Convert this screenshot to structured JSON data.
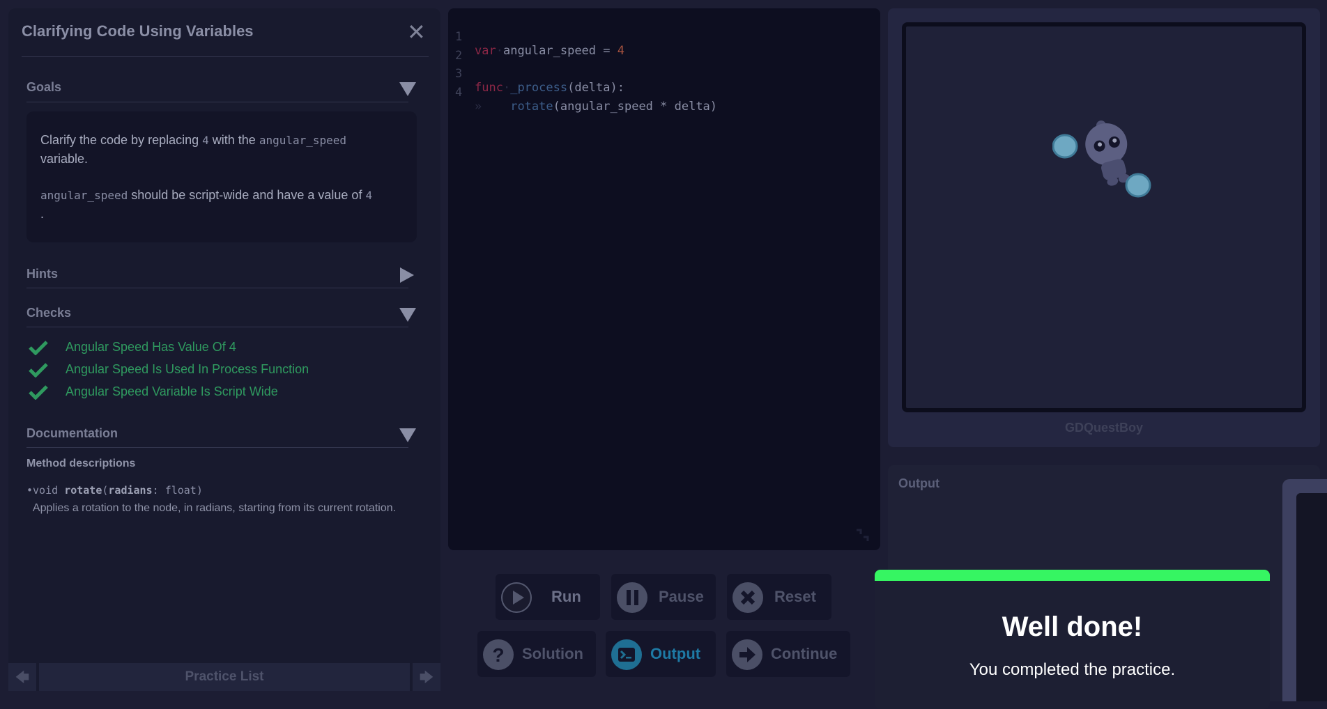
{
  "panel": {
    "title": "Clarifying Code Using Variables",
    "close_icon": "✕"
  },
  "goals": {
    "title": "Goals",
    "line1_a": "Clarify the code by replacing ",
    "line1_code1": "4",
    "line1_b": " with the ",
    "line1_code2": "angular_speed",
    "line1_c": "variable.",
    "line2_code1": "angular_speed",
    "line2_a": " should be script-wide and have a value of ",
    "line2_code2": "4",
    "line2_b": "."
  },
  "hints": {
    "title": "Hints"
  },
  "checks": {
    "title": "Checks",
    "items": [
      "Angular Speed Has Value Of 4",
      "Angular Speed Is Used In Process Function",
      "Angular Speed Variable Is Script Wide"
    ],
    "color": "#2f9a5f"
  },
  "documentation": {
    "title": "Documentation",
    "method_heading": "Method descriptions",
    "bullet": "•",
    "sig_void": "void ",
    "sig_name": "rotate",
    "sig_open": "(",
    "sig_param": "radians",
    "sig_colon": ": ",
    "sig_type": "float",
    "sig_close": ")",
    "description": "Applies a rotation to the node, in radians, starting from its current rotation."
  },
  "footer": {
    "prev_icon": "🡄",
    "label": "Practice List",
    "next_icon": "🡆"
  },
  "editor": {
    "lines": [
      {
        "num": "1",
        "kw": "var",
        "sep": "·",
        "text": "angular_speed",
        "eq": " = ",
        "value": "4"
      },
      {
        "num": "2"
      },
      {
        "num": "3",
        "kw": "func",
        "sep": "·",
        "fn": "_process",
        "rest": "(delta):"
      },
      {
        "num": "4",
        "tab": "»",
        "fn": "rotate",
        "rest": "(angular_speed * delta)"
      }
    ]
  },
  "controls": {
    "run": "Run",
    "pause": "Pause",
    "reset": "Reset",
    "solution": "Solution",
    "output": "Output",
    "continue": "Continue"
  },
  "viewport": {
    "scene_name": "GDQuestBoy"
  },
  "output": {
    "title": "Output"
  },
  "modal": {
    "title": "Well done!",
    "subtitle": "You completed the practice.",
    "bar_color": "#36f562"
  }
}
